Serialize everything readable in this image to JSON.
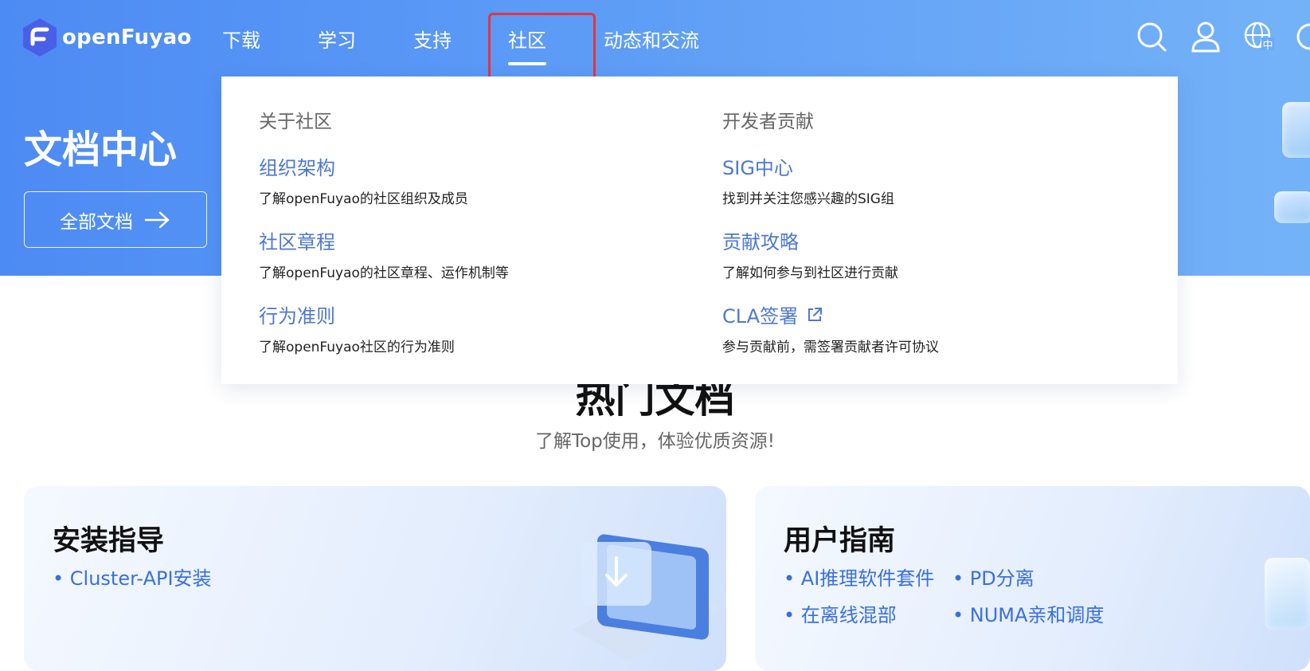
{
  "brand": {
    "name": "openFuyao"
  },
  "nav": {
    "items": [
      "下载",
      "学习",
      "支持",
      "社区",
      "动态和交流"
    ],
    "active_index": 3
  },
  "hero": {
    "title": "文档中心",
    "all_docs_label": "全部文档"
  },
  "dropdown": {
    "left": {
      "heading": "关于社区",
      "items": [
        {
          "title": "组织架构",
          "desc": "了解openFuyao的社区组织及成员"
        },
        {
          "title": "社区章程",
          "desc": "了解openFuyao的社区章程、运作机制等"
        },
        {
          "title": "行为准则",
          "desc": "了解openFuyao社区的行为准则"
        }
      ]
    },
    "right": {
      "heading": "开发者贡献",
      "items": [
        {
          "title": "SIG中心",
          "desc": "找到并关注您感兴趣的SIG组"
        },
        {
          "title": "贡献攻略",
          "desc": "了解如何参与到社区进行贡献"
        },
        {
          "title": "CLA签署",
          "desc": "参与贡献前，需签署贡献者许可协议",
          "external": true
        }
      ]
    }
  },
  "hot_docs": {
    "title": "热门文档",
    "subtitle": "了解Top使用，体验优质资源!"
  },
  "cards": [
    {
      "title": "安装指导",
      "links": [
        "• Cluster-API安装"
      ]
    },
    {
      "title": "用户指南",
      "links": [
        "• AI推理软件套件",
        "• PD分离",
        "• 在离线混部",
        "• NUMA亲和调度"
      ]
    }
  ],
  "icons": {
    "search": "search-icon",
    "user": "user-icon",
    "language": "globe-language-icon",
    "theme": "theme-icon",
    "arrow": "arrow-right-icon",
    "external": "external-link-icon"
  },
  "colors": {
    "hero_blue": "#5d9cf6",
    "link_blue": "#4e78cf",
    "highlight_red": "#e8333b"
  }
}
